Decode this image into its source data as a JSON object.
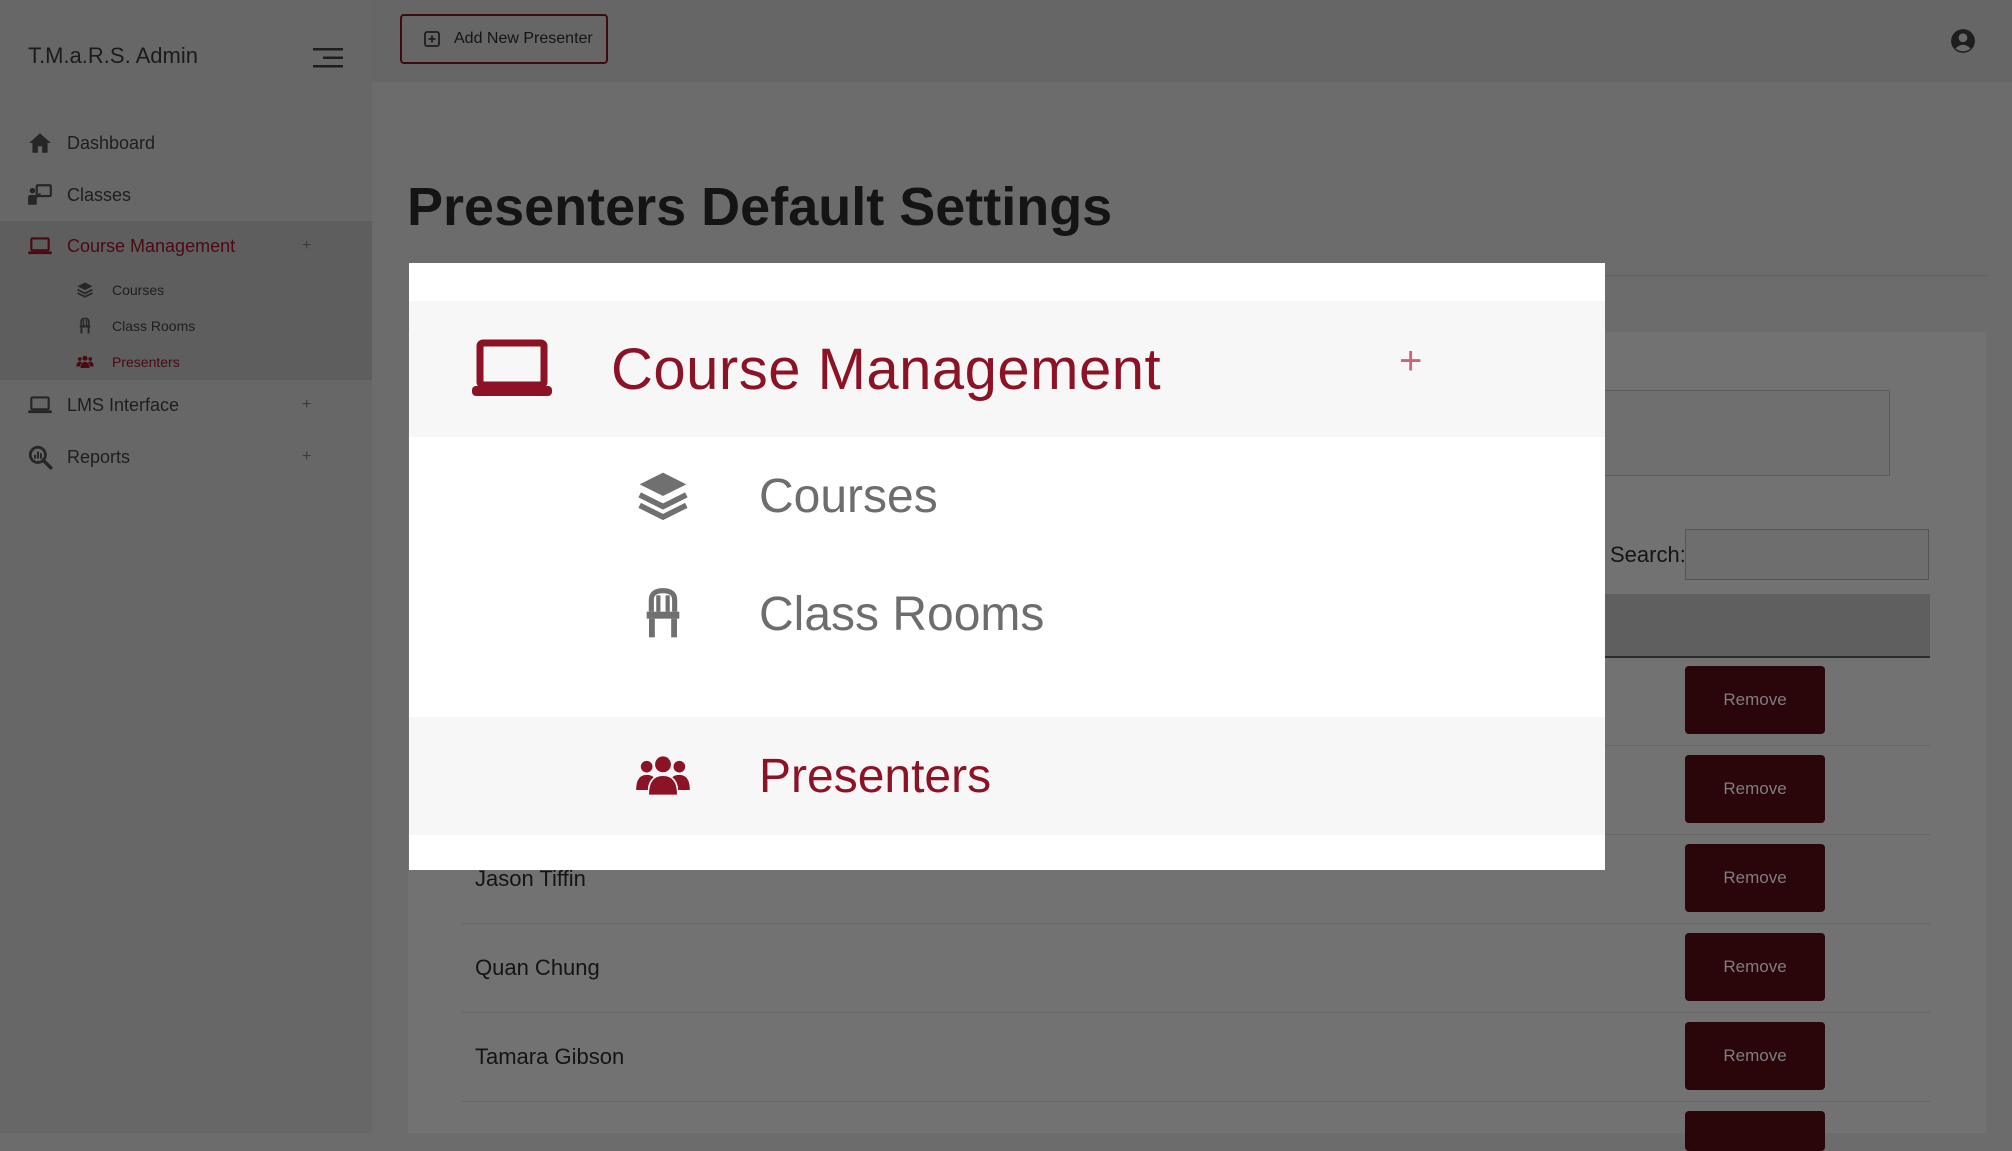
{
  "app": {
    "title": "T.M.a.R.S. Admin"
  },
  "sidebar": {
    "items": [
      {
        "label": "Dashboard",
        "icon": "home-icon"
      },
      {
        "label": "Classes",
        "icon": "chalkboard-teacher-icon"
      },
      {
        "label": "Course Management",
        "icon": "laptop-icon",
        "expander": "+",
        "active": true,
        "children": [
          {
            "label": "Courses",
            "icon": "layer-group-icon"
          },
          {
            "label": "Class Rooms",
            "icon": "chair-icon"
          },
          {
            "label": "Presenters",
            "icon": "users-icon",
            "current": true
          }
        ]
      },
      {
        "label": "LMS Interface",
        "icon": "laptop-icon",
        "expander": "+"
      },
      {
        "label": "Reports",
        "icon": "search-chart-icon",
        "expander": "+"
      }
    ]
  },
  "header": {
    "add_button_label": "Add New Presenter",
    "add_icon": "plus-square-icon",
    "user_icon": "user-circle-icon"
  },
  "main": {
    "title": "Presenters Default Settings",
    "search_label": "Search:",
    "search_value": "",
    "rows": [
      {
        "name": "",
        "action": "Remove"
      },
      {
        "name": "",
        "action": "Remove"
      },
      {
        "name": "Jason Tiffin",
        "action": "Remove"
      },
      {
        "name": "Quan Chung",
        "action": "Remove"
      },
      {
        "name": "Tamara Gibson",
        "action": "Remove"
      },
      {
        "name": "",
        "action": ""
      }
    ]
  },
  "colors": {
    "accent": "#8c1226",
    "button_dark": "#2a0509",
    "overlay": "#6c6c6c"
  }
}
